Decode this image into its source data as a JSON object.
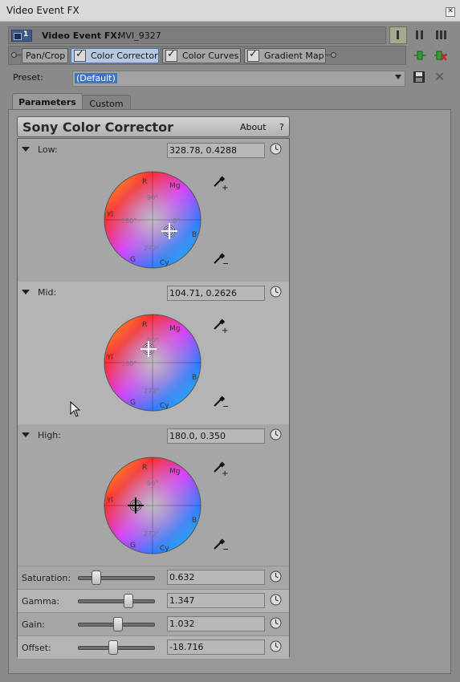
{
  "window": {
    "title": "Video Event FX"
  },
  "header": {
    "track_number": "1",
    "label": "Video Event FX:",
    "value": "MVI_9327"
  },
  "chain": {
    "items": [
      {
        "label": "Pan/Crop",
        "checkbox": false,
        "selected": false
      },
      {
        "label": "Color Corrector",
        "checkbox": true,
        "selected": true
      },
      {
        "label": "Color Curves",
        "checkbox": true,
        "selected": false
      },
      {
        "label": "Gradient Map",
        "checkbox": true,
        "selected": false
      }
    ]
  },
  "preset": {
    "label": "Preset:",
    "value": "(Default)"
  },
  "tabs": [
    {
      "label": "Parameters",
      "active": true
    },
    {
      "label": "Custom",
      "active": false
    }
  ],
  "plugin": {
    "name": "Sony Color Corrector",
    "about_label": "About",
    "help_label": "?"
  },
  "wheel_labels": {
    "r": "R",
    "mg": "Mg",
    "b": "B",
    "cy": "Cy",
    "g": "G",
    "yl": "Yl",
    "deg90": "90°",
    "deg180": "180°",
    "deg270": "270°",
    "deg0": "0°"
  },
  "sections": [
    {
      "label": "Low:",
      "value": "328.78, 0.4288"
    },
    {
      "label": "Mid:",
      "value": "104.71, 0.2626"
    },
    {
      "label": "High:",
      "value": "180.0, 0.350"
    }
  ],
  "sliders": [
    {
      "label": "Saturation:",
      "value": "0.632",
      "level": 0.2
    },
    {
      "label": "Gamma:",
      "value": "1.347",
      "level": 0.68
    },
    {
      "label": "Gain:",
      "value": "1.032",
      "level": 0.52
    },
    {
      "label": "Offset:",
      "value": "-18.716",
      "level": 0.45
    }
  ],
  "colors": {
    "accent": "#3f73c4",
    "panel": "#989898",
    "selected_fx": "#b7c9e2"
  }
}
